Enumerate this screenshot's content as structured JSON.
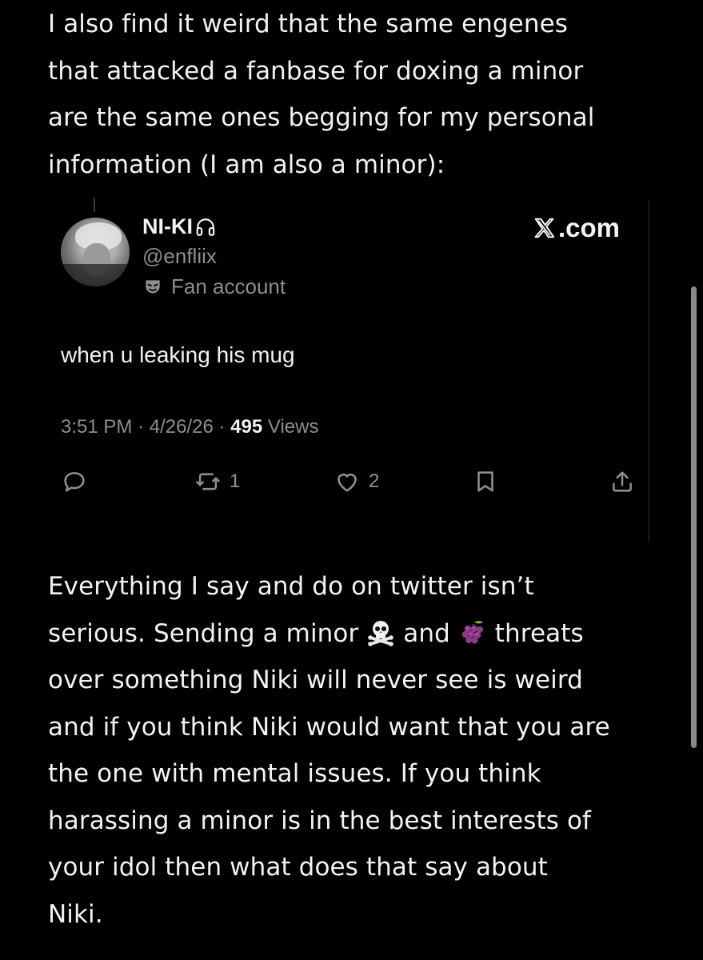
{
  "post_intro": {
    "lines": [
      "I also find it weird that the same engenes",
      "that attacked a fanbase for doxing a minor",
      "are the same ones begging for my personal",
      "information (I am also a minor):"
    ]
  },
  "embedded_tweet": {
    "author_name": "NI-KI",
    "name_icon": "headphones-icon",
    "handle": "@enfliix",
    "account_label": "Fan account",
    "account_label_icon": "mask-icon",
    "source": ".com",
    "source_logo": "x-logo",
    "text": "when u leaking his mug",
    "time": "3:51 PM",
    "date": "4/26/26",
    "views_count": "495",
    "views_label": "Views",
    "separator": "·",
    "actions": {
      "reply": {
        "icon": "reply-icon",
        "count": ""
      },
      "repost": {
        "icon": "repost-icon",
        "count": "1"
      },
      "like": {
        "icon": "heart-icon",
        "count": "2"
      },
      "bookmark": {
        "icon": "bookmark-icon",
        "count": ""
      },
      "share": {
        "icon": "share-icon",
        "count": ""
      }
    }
  },
  "post_body": {
    "line1": "Everything I say and do on twitter isn’t",
    "line2_a": "serious. Sending a minor ",
    "line2_emoji1": "skull-and-crossbones",
    "line2_b": " and ",
    "line2_emoji2": "grapes",
    "line2_c": " threats",
    "line3": "over something Niki will never see is weird",
    "line4": "and if you think Niki would want that you are",
    "line5": "the one with mental issues. If you think",
    "line6": "harassing a minor is in the best interests of",
    "line7": "your idol then what does that say about",
    "line8": "Niki."
  },
  "colors": {
    "background": "#000000",
    "text_primary": "#f2f2f2",
    "text_secondary": "#8e8e8e",
    "scrollbar": "#8b8b8b"
  }
}
